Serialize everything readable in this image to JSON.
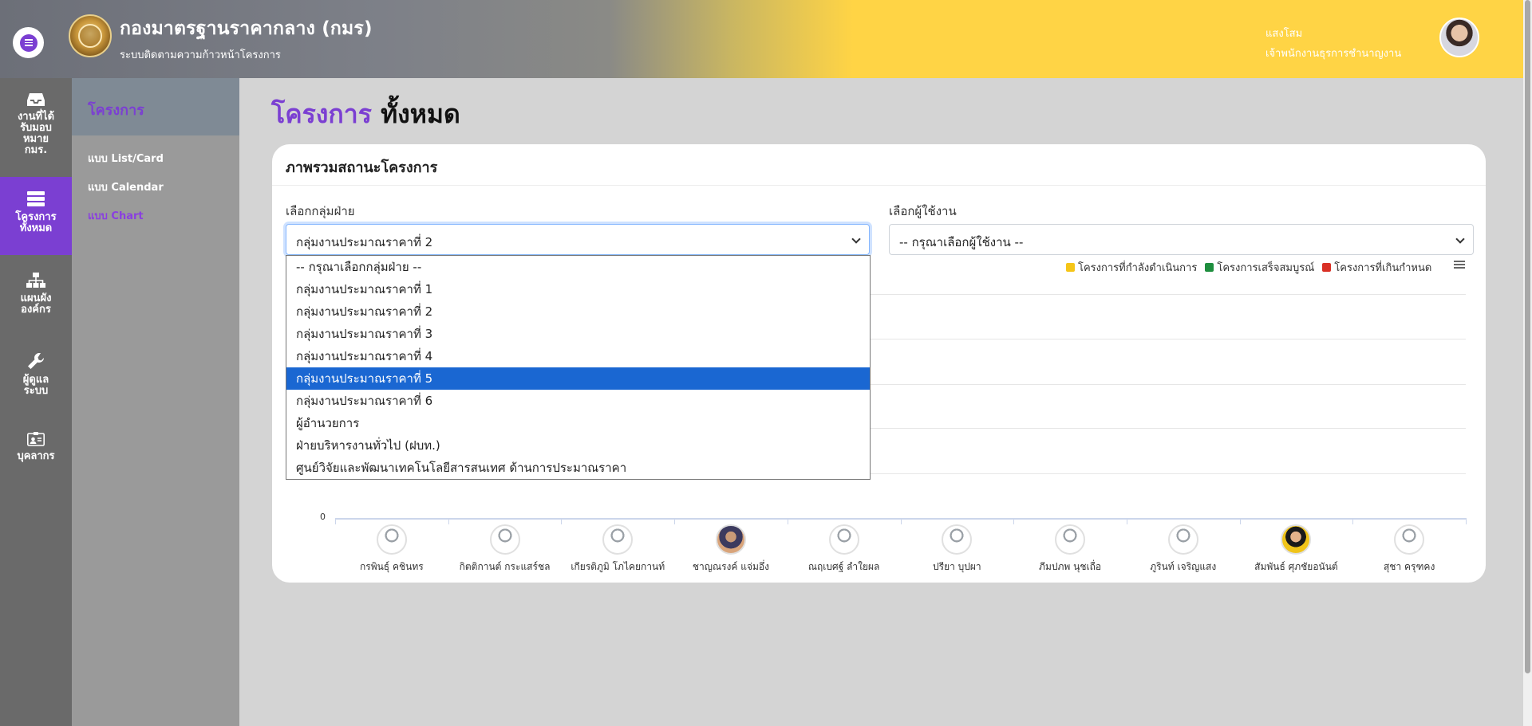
{
  "header": {
    "org_title": "กองมาตรฐานราคากลาง (กมร)",
    "org_subtitle": "ระบบติดตามความก้าวหน้าโครงการ",
    "user_name": "แสงโสม",
    "user_role": "เจ้าพนักงานธุรการชำนาญงาน"
  },
  "sidebar": {
    "items": [
      {
        "label": "งานที่ได้รับมอบหมาย กมร.",
        "icon": "inbox-icon"
      },
      {
        "label": "โครงการทั้งหมด",
        "icon": "table-icon"
      },
      {
        "label": "แผนผังองค์กร",
        "icon": "sitemap-icon"
      },
      {
        "label": "ผู้ดูแลระบบ",
        "icon": "wrench-icon"
      },
      {
        "label": "บุคลากร",
        "icon": "id-card-icon"
      }
    ]
  },
  "subnav": {
    "title": "โครงการ",
    "links": [
      "แบบ List/Card",
      "แบบ Calendar",
      "แบบ Chart"
    ]
  },
  "page": {
    "title_part1": "โครงการ",
    "title_part2": "ทั้งหมด"
  },
  "card": {
    "title": "ภาพรวมสถานะโครงการ",
    "group_label": "เลือกกลุ่มฝ่าย",
    "group_value": "กลุ่มงานประมาณราคาที่ 2",
    "user_label": "เลือกผู้ใช้งาน",
    "user_value": "-- กรุณาเลือกผู้ใช้งาน --"
  },
  "dropdown_options": [
    "-- กรุณาเลือกกลุ่มฝ่าย --",
    "กลุ่มงานประมาณราคาที่ 1",
    "กลุ่มงานประมาณราคาที่ 2",
    "กลุ่มงานประมาณราคาที่ 3",
    "กลุ่มงานประมาณราคาที่ 4",
    "กลุ่มงานประมาณราคาที่ 5",
    "กลุ่มงานประมาณราคาที่ 6",
    "ผู้อำนวยการ",
    "ฝ่ายบริหารงานทั่วไป (ฝบท.)",
    "ศูนย์วิจัยและพัฒนาเทคโนโลยีสารสนเทศ ด้านการประมาณราคา"
  ],
  "dropdown_highlighted_index": 5,
  "chart_data": {
    "type": "bar",
    "legend": [
      {
        "name": "โครงการที่กำลังดำเนินการ",
        "color": "#f5c518"
      },
      {
        "name": "โครงการเสร็จสมบูรณ์",
        "color": "#1e8e3e"
      },
      {
        "name": "โครงการที่เกินกำหนด",
        "color": "#d93025"
      }
    ],
    "y_tick_labels": [
      "0"
    ],
    "categories": [
      "กรพินธุ์ คชินทร",
      "กิตติกานต์ กระแสร์ชล",
      "เกียรติภูมิ โภไคยกานท์",
      "ชาญณรงค์ แจ่มอึ่ง",
      "ณฤเบศฐ์ ลำใยผล",
      "ปรียา บุปผา",
      "ภีมปภพ นุชเถื่อ",
      "ภูรินท์ เจริญแสง",
      "สัมพันธ์ ศุภชัยอนันต์",
      "สุชา ครุฑคง"
    ],
    "legend_position": "top-right",
    "grid": true
  },
  "colors": {
    "accent": "#7b3fd2",
    "header_yellow": "#ffd445",
    "selected_option": "#1a67d2"
  }
}
